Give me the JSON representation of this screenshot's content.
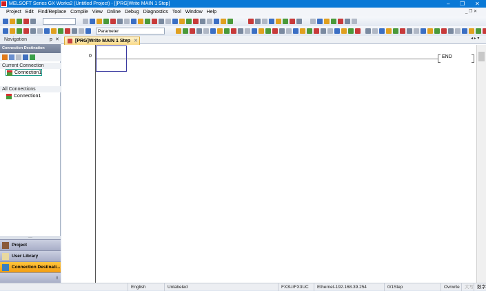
{
  "window": {
    "title": "MELSOFT Series GX Works2 (Untitled Project) - [[PRG]Write MAIN 1 Step]",
    "minimize": "–",
    "restore": "❐",
    "close": "✕"
  },
  "menu": [
    "Project",
    "Edit",
    "Find/Replace",
    "Compile",
    "View",
    "Online",
    "Debug",
    "Diagnostics",
    "Tool",
    "Window",
    "Help"
  ],
  "toolbar": {
    "combo1": "",
    "combo2": "Parameter"
  },
  "navigation": {
    "title": "Navigation",
    "pin": "ᵽ",
    "close": "✕",
    "header": "Connection Destination",
    "current_section": "Current Connection",
    "current_item": "Connection1",
    "all_section": "All Connections",
    "all_item": "Connection1",
    "buttons": [
      {
        "label": "Project"
      },
      {
        "label": "User Library"
      },
      {
        "label": "Connection Destinati..."
      }
    ],
    "active_button_color": "#f5a623"
  },
  "editor": {
    "tab": "[PRG]Write MAIN 1 Step",
    "tab_close": "✕",
    "step": "0",
    "end": "END"
  },
  "status": {
    "language": "English",
    "label": "Unlabeled",
    "plc": "FX3U/FX3UC",
    "connection": "Ethernet-192.168.39.254",
    "steps": "0/1Step",
    "mode": "Ovrwrte",
    "caps": "大写",
    "num": "数字"
  }
}
